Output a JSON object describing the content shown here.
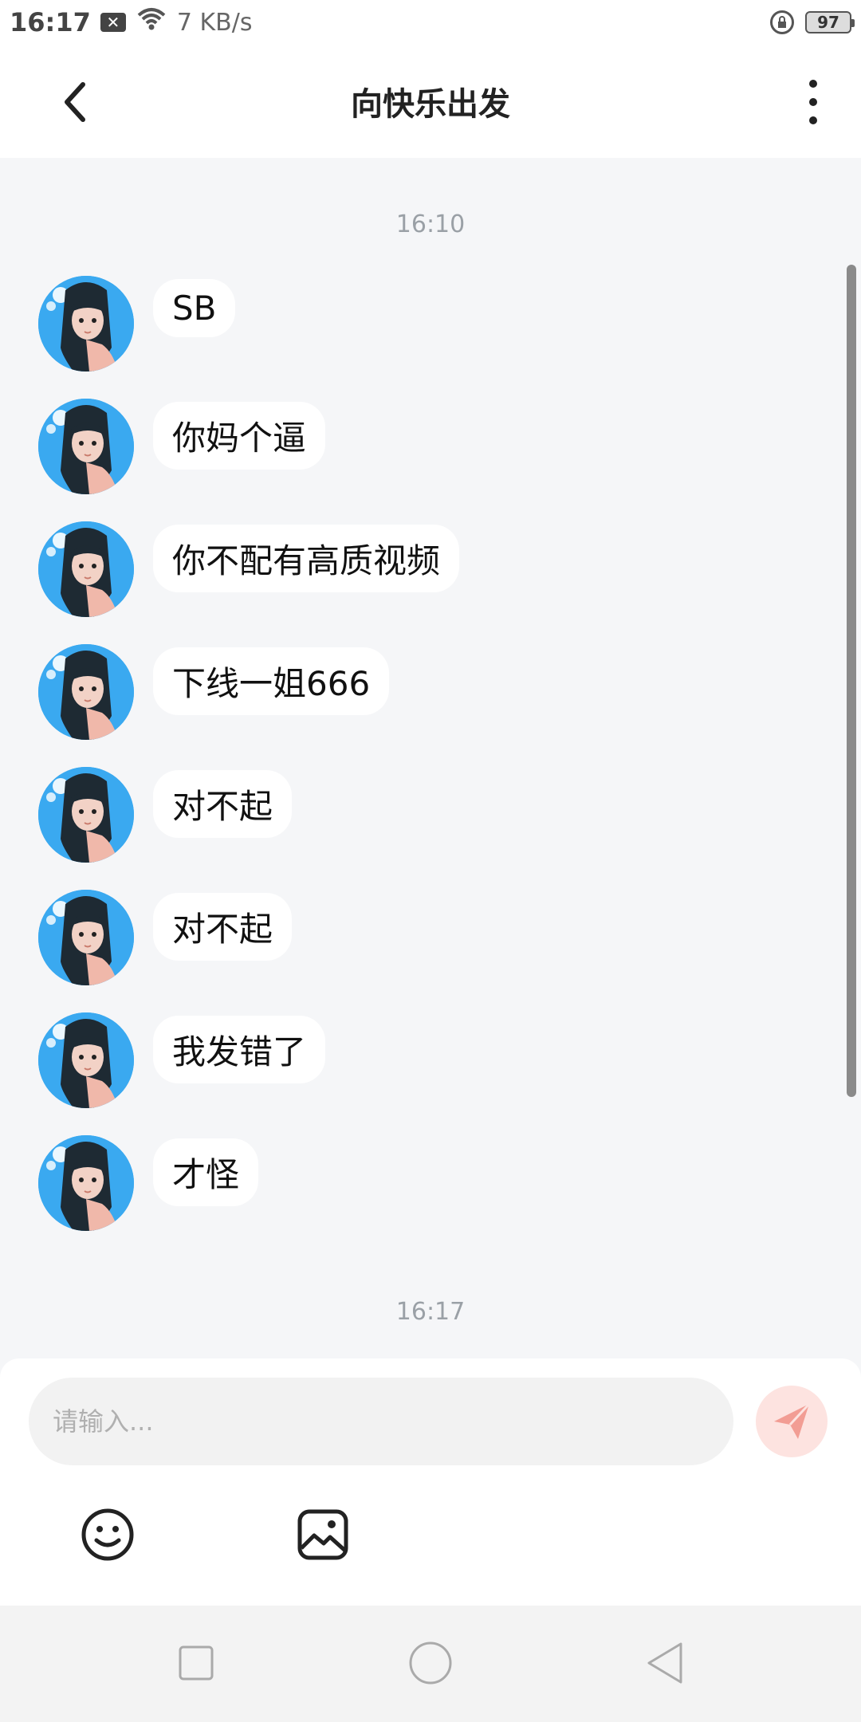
{
  "status_bar": {
    "time": "16:17",
    "speed": "7 KB/s",
    "battery": "97"
  },
  "header": {
    "title": "向快乐出发"
  },
  "chat": {
    "time_top": "16:10",
    "messages": [
      "SB",
      "你妈个逼",
      "你不配有高质视频",
      "下线一姐666",
      "对不起",
      "对不起",
      "我发错了",
      "才怪"
    ],
    "time_bottom": "16:17"
  },
  "composer": {
    "placeholder": "请输入..."
  },
  "icons": {
    "back": "chevron-left-icon",
    "more": "more-vertical-icon",
    "emoji": "emoji-icon",
    "image": "image-icon",
    "send": "send-icon"
  },
  "colors": {
    "background": "#f5f6f8",
    "bubble": "#ffffff",
    "send_bg": "#fde3e0",
    "send_fg": "#f29d94"
  }
}
